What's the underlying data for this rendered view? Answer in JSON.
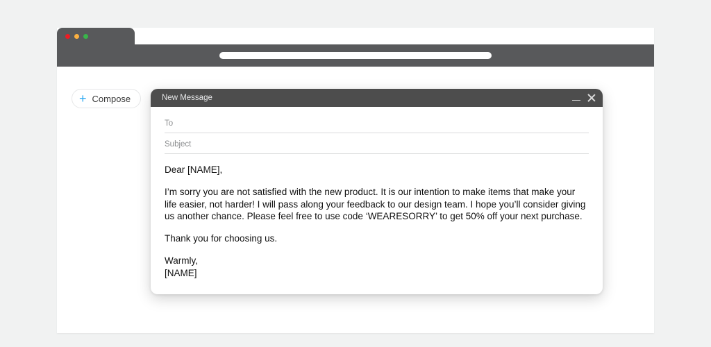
{
  "compose": {
    "label": "Compose"
  },
  "message": {
    "title": "New Message",
    "to_label": "To",
    "subject_label": "Subject",
    "body": {
      "greeting": "Dear [NAME],",
      "p1": "I’m sorry you are not satisfied with the new product. It is our intention to make items that make your life easier, not harder! I will pass along your feedback to our design team. I hope you’ll consider giving us another chance. Please feel free to use code ‘WEARESORRY’ to get 50% off your next purchase.",
      "p2": "Thank you for choosing us.",
      "signoff": "Warmly,",
      "signature": "[NAME]"
    }
  }
}
